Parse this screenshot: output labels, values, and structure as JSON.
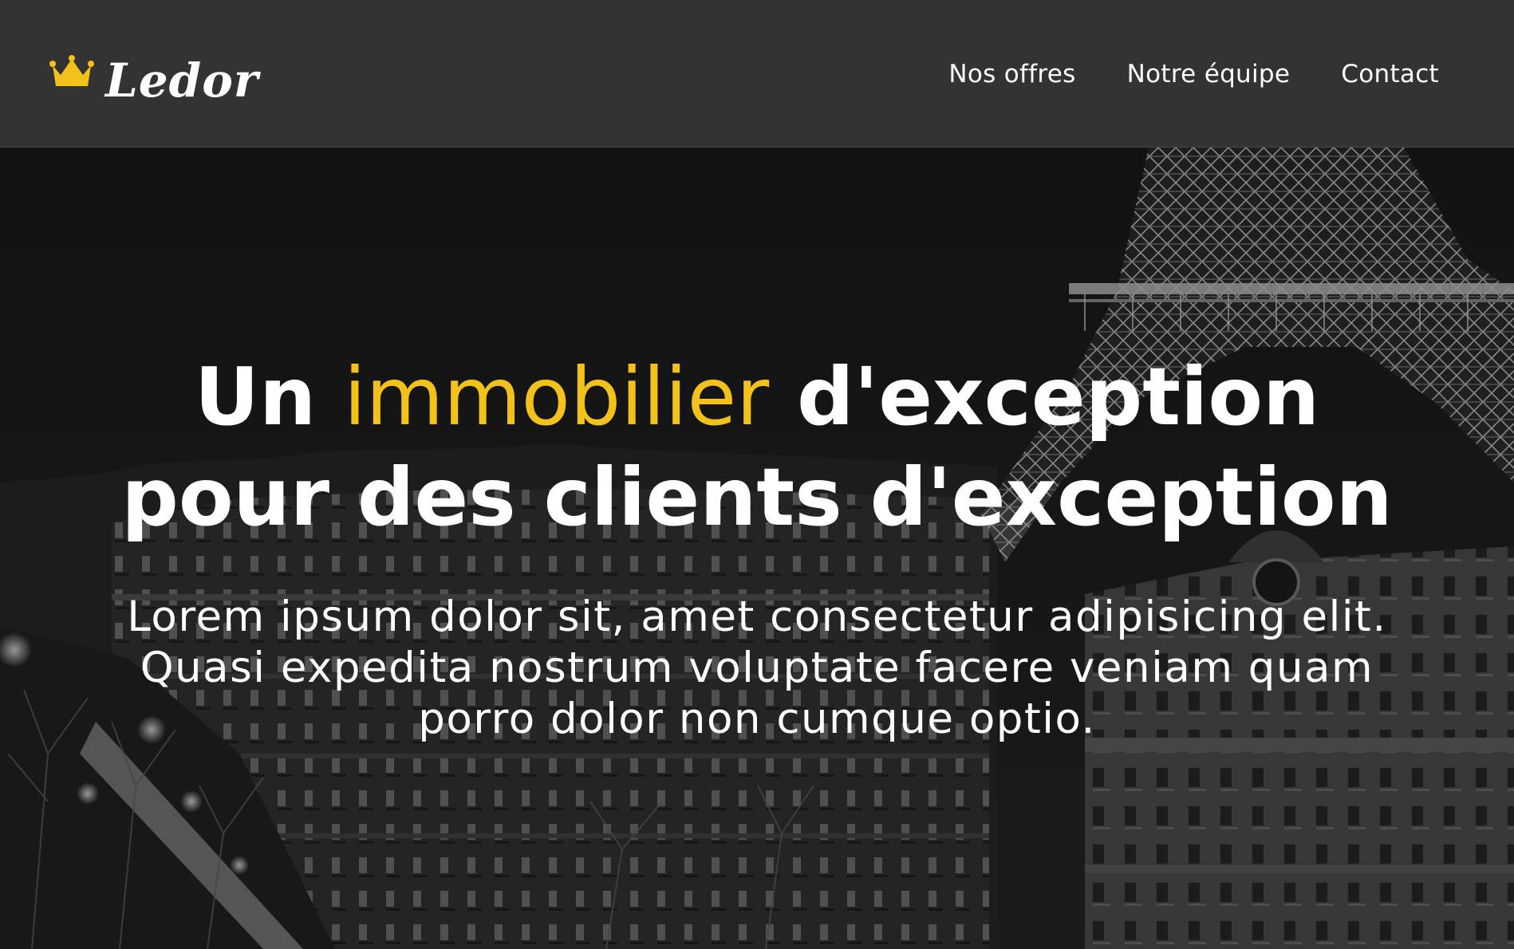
{
  "brand": {
    "name": "Ledor",
    "crown_icon": "crown-icon",
    "accent_color": "#f2c21b"
  },
  "nav": {
    "items": [
      {
        "label": "Nos offres"
      },
      {
        "label": "Notre équipe"
      },
      {
        "label": "Contact"
      }
    ]
  },
  "hero": {
    "title_part1": "Un ",
    "title_accent": "immobilier",
    "title_part2": " d'exception pour des clients d'exception",
    "subtitle": "Lorem ipsum dolor sit, amet consectetur adipisicing elit. Quasi expedita nostrum voluptate facere veniam quam porro dolor non cumque optio."
  },
  "colors": {
    "header_bg": "#333333",
    "text": "#ffffff",
    "accent": "#f2c21b"
  }
}
